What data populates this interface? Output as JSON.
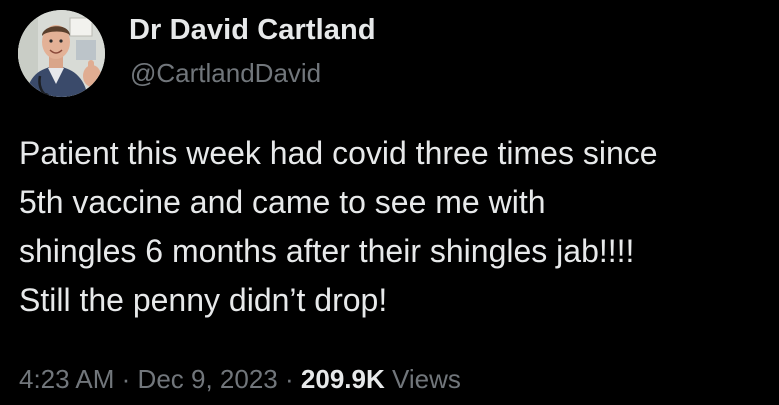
{
  "author": {
    "name": "Dr David Cartland",
    "handle": "@CartlandDavid",
    "avatar_icon": "profile-photo"
  },
  "tweet": {
    "lines": [
      "Patient this week had covid three times since",
      "5th vaccine and came to see me with",
      "shingles 6 months after their shingles jab!!!!",
      "Still the penny didn’t drop!"
    ]
  },
  "meta": {
    "time": "4:23 AM",
    "separator": "·",
    "date": "Dec 9, 2023",
    "view_count": "209.9K",
    "views_label": "Views"
  },
  "colors": {
    "background": "#000000",
    "primary_text": "#e7e9ea",
    "secondary_text": "#71767b"
  }
}
